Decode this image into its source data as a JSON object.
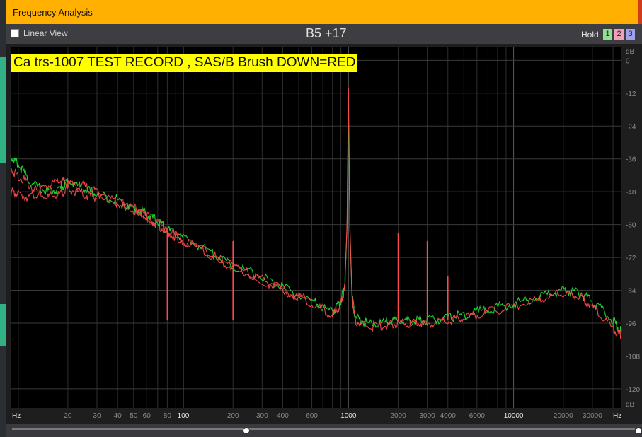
{
  "window": {
    "title": "Frequency Analysis"
  },
  "toolbar": {
    "linear_view_label": "Linear View",
    "note_readout": "B5 +17",
    "hold_label": "Hold",
    "hold_buttons": [
      {
        "label": "1",
        "color": "#8fe08f"
      },
      {
        "label": "2",
        "color": "#f0a0b8"
      },
      {
        "label": "3",
        "color": "#a0a0f0"
      }
    ]
  },
  "overlay": {
    "label": "Ca trs-1007 TEST RECORD , SAS/B Brush DOWN=RED"
  },
  "scrollbar": {
    "divider_label": "|"
  },
  "chart_data": {
    "type": "line",
    "x_scale": "log",
    "xlim": [
      9,
      45000
    ],
    "ylim": [
      -127,
      5
    ],
    "x_unit": "Hz",
    "y_unit": "dB",
    "grid": true,
    "background": "#000000",
    "x_ticks": [
      {
        "value": 20,
        "label": "20",
        "bold": false
      },
      {
        "value": 30,
        "label": "30",
        "bold": false
      },
      {
        "value": 40,
        "label": "40",
        "bold": false
      },
      {
        "value": 50,
        "label": "50",
        "bold": false
      },
      {
        "value": 60,
        "label": "60",
        "bold": false
      },
      {
        "value": 80,
        "label": "80",
        "bold": false
      },
      {
        "value": 100,
        "label": "100",
        "bold": true
      },
      {
        "value": 200,
        "label": "200",
        "bold": false
      },
      {
        "value": 300,
        "label": "300",
        "bold": false
      },
      {
        "value": 400,
        "label": "400",
        "bold": false
      },
      {
        "value": 600,
        "label": "600",
        "bold": false
      },
      {
        "value": 1000,
        "label": "1000",
        "bold": true
      },
      {
        "value": 2000,
        "label": "2000",
        "bold": false
      },
      {
        "value": 3000,
        "label": "3000",
        "bold": false
      },
      {
        "value": 4000,
        "label": "4000",
        "bold": false
      },
      {
        "value": 6000,
        "label": "6000",
        "bold": false
      },
      {
        "value": 10000,
        "label": "10000",
        "bold": true
      },
      {
        "value": 20000,
        "label": "20000",
        "bold": false
      },
      {
        "value": 30000,
        "label": "30000",
        "bold": false
      }
    ],
    "y_ticks": [
      {
        "value": 0,
        "label": "0"
      },
      {
        "value": -12,
        "label": "-12"
      },
      {
        "value": -24,
        "label": "-24"
      },
      {
        "value": -36,
        "label": "-36"
      },
      {
        "value": -48,
        "label": "-48"
      },
      {
        "value": -60,
        "label": "-60"
      },
      {
        "value": -72,
        "label": "-72"
      },
      {
        "value": -84,
        "label": "-84"
      },
      {
        "value": -96,
        "label": "-96"
      },
      {
        "value": -108,
        "label": "-108"
      },
      {
        "value": -120,
        "label": "-120"
      }
    ],
    "x_axis_unit_labels": [
      "Hz",
      "Hz"
    ],
    "y_axis_unit_labels": [
      "dB",
      "dB"
    ],
    "series": [
      {
        "color": "#22dd33",
        "x": [
          9,
          10,
          12,
          15,
          18,
          20,
          25,
          30,
          40,
          50,
          60,
          70,
          80,
          100,
          150,
          200,
          300,
          400,
          600,
          800,
          900,
          950,
          980,
          1000,
          1020,
          1050,
          1100,
          1300,
          1700,
          2000,
          2500,
          3000,
          4000,
          5000,
          7000,
          10000,
          15000,
          20000,
          25000,
          30000,
          40000,
          45000
        ],
        "y": [
          -35,
          -38,
          -45,
          -48,
          -47,
          -44,
          -47,
          -49,
          -51,
          -54,
          -56,
          -59,
          -62,
          -65,
          -70,
          -75,
          -79,
          -83,
          -88,
          -92,
          -88,
          -82,
          -62,
          -16,
          -62,
          -85,
          -94,
          -96,
          -96,
          -95,
          -95,
          -95,
          -94,
          -93,
          -91,
          -89,
          -86,
          -84,
          -85,
          -88,
          -95,
          -99
        ]
      },
      {
        "color": "#ff4a4a",
        "x": [
          9,
          10,
          12,
          15,
          18,
          20,
          25,
          30,
          40,
          50,
          60,
          70,
          80,
          100,
          150,
          200,
          300,
          400,
          600,
          800,
          900,
          950,
          980,
          1000,
          1020,
          1050,
          1100,
          1300,
          1700,
          2000,
          2500,
          3000,
          4000,
          5000,
          7000,
          10000,
          15000,
          20000,
          25000,
          30000,
          40000,
          45000
        ],
        "y": [
          -48,
          -49,
          -50,
          -46,
          -44,
          -45,
          -46,
          -48,
          -52,
          -55,
          -57,
          -60,
          -63,
          -66,
          -71,
          -76,
          -80,
          -84,
          -89,
          -93,
          -89,
          -83,
          -60,
          -10,
          -60,
          -86,
          -95,
          -97,
          -97,
          -96,
          -96,
          -96,
          -95,
          -94,
          -92,
          -90,
          -87,
          -85,
          -86,
          -90,
          -98,
          -101
        ]
      },
      {
        "color": "#e34848",
        "x": [
          9,
          10,
          12,
          15,
          18,
          20,
          25,
          30,
          40,
          50,
          60,
          80,
          100,
          200,
          400,
          600
        ],
        "y": [
          -40,
          -42,
          -46,
          -50,
          -49,
          -47,
          -49,
          -50,
          -52,
          -54,
          -57,
          -62,
          -66,
          -75,
          -84,
          -88
        ]
      }
    ],
    "spikes": [
      {
        "x": 2000,
        "y": -63,
        "color": "#ff4a4a"
      },
      {
        "x": 3000,
        "y": -66,
        "color": "#ff4a4a"
      },
      {
        "x": 4000,
        "y": -79,
        "color": "#ff4a4a"
      },
      {
        "x": 200,
        "y": -66,
        "color": "#ff4a4a"
      },
      {
        "x": 80,
        "y": -62,
        "color": "#ff4a4a"
      }
    ]
  }
}
